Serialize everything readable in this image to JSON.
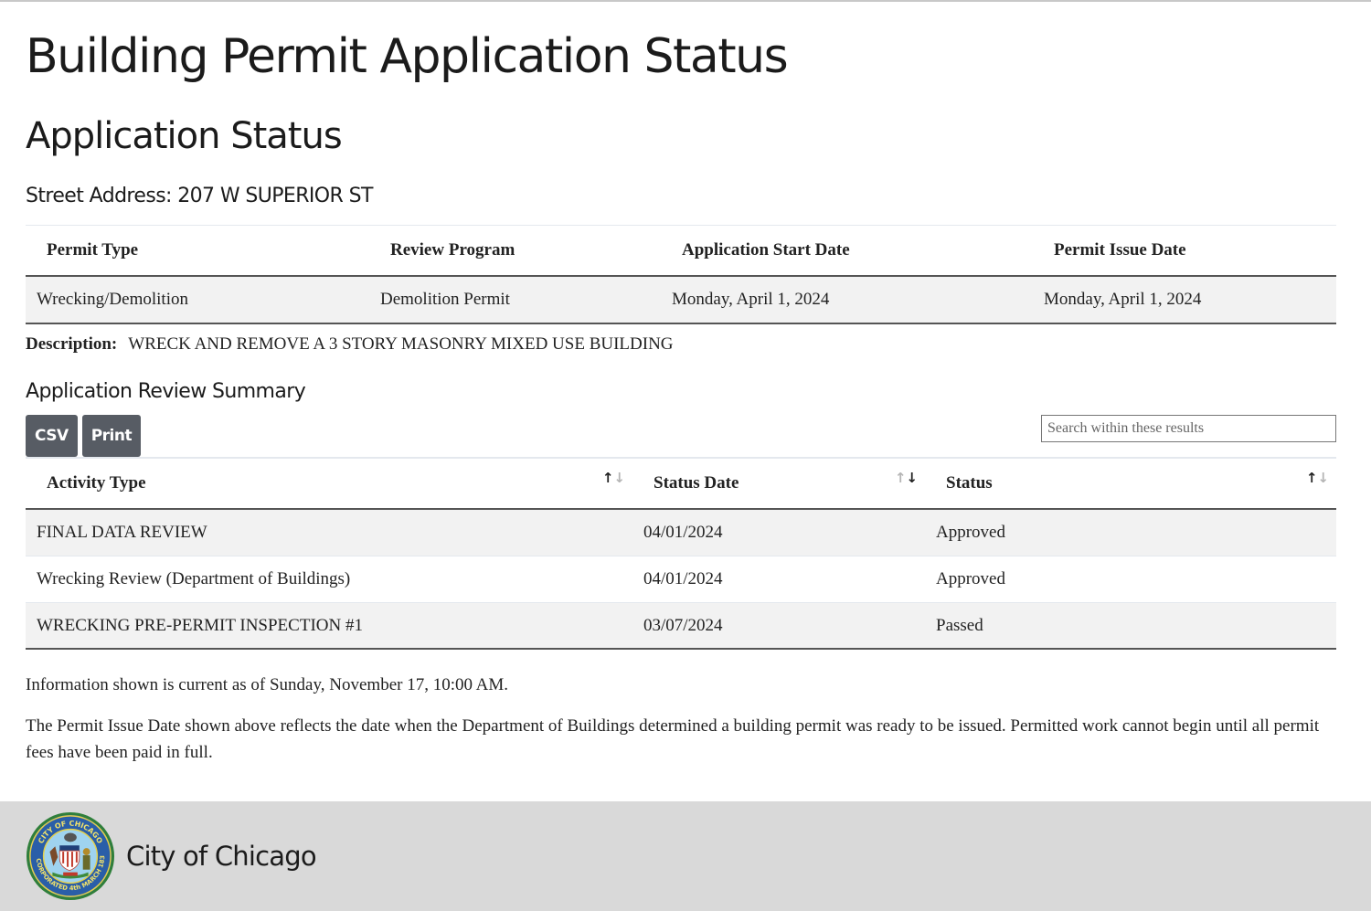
{
  "page": {
    "title": "Building Permit Application Status",
    "subtitle": "Application Status",
    "street_address": "Street Address: 207 W SUPERIOR ST"
  },
  "permit": {
    "headers": [
      "Permit Type",
      "Review Program",
      "Application Start Date",
      "Permit Issue Date"
    ],
    "row": [
      "Wrecking/Demolition",
      "Demolition Permit",
      "Monday, April 1, 2024",
      "Monday, April 1, 2024"
    ],
    "description_label": "Description:",
    "description": "WRECK AND REMOVE A 3 STORY MASONRY MIXED USE BUILDING"
  },
  "review": {
    "title": "Application Review Summary",
    "buttons": {
      "csv": "CSV",
      "print": "Print"
    },
    "search_placeholder": "Search within these results",
    "search_value": "",
    "headers": [
      "Activity Type",
      "Status Date",
      "Status"
    ],
    "sort_icon": {
      "up": "↑",
      "down": "↓"
    },
    "rows": [
      [
        "FINAL DATA REVIEW",
        "04/01/2024",
        "Approved"
      ],
      [
        "Wrecking Review (Department of Buildings)",
        "04/01/2024",
        "Approved"
      ],
      [
        "WRECKING PRE-PERMIT INSPECTION #1",
        "03/07/2024",
        "Passed"
      ]
    ]
  },
  "notes": {
    "current_as_of": "Information shown is current as of Sunday, November 17, 10:00 AM.",
    "disclaimer": "The Permit Issue Date shown above reflects the date when the Department of Buildings determined a building permit was ready to be issued. Permitted work cannot begin until all permit fees have been paid in full."
  },
  "footer": {
    "title": "City of Chicago",
    "seal_icon": "city-seal-icon",
    "seal_text_top": "CITY OF CHICAGO",
    "seal_text_bottom": "INCORPORATED 4th MARCH 1837"
  },
  "colors": {
    "button_bg": "#575c64",
    "footer_bg": "#d9d9d9",
    "row_stripe": "#f2f2f2"
  }
}
